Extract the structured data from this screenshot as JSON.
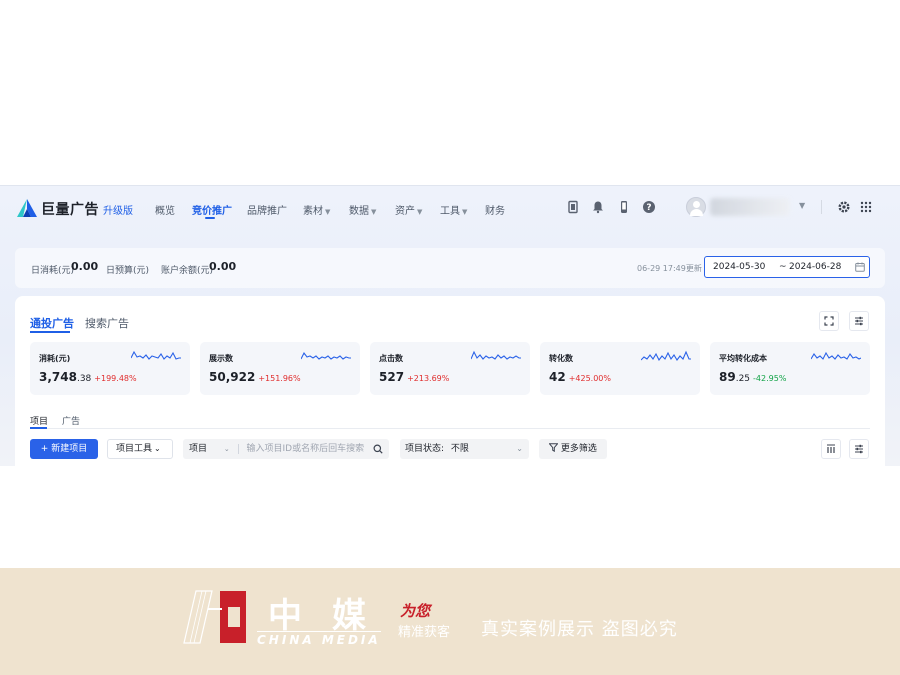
{
  "nav": {
    "brand": "巨量广告",
    "upgrade": "升级版",
    "items": [
      {
        "label": "概览"
      },
      {
        "label": "竞价推广",
        "active": true
      },
      {
        "label": "品牌推广"
      },
      {
        "label": "素材",
        "dropdown": true
      },
      {
        "label": "数据",
        "dropdown": true
      },
      {
        "label": "资产",
        "dropdown": true
      },
      {
        "label": "工具",
        "dropdown": true
      },
      {
        "label": "财务"
      }
    ],
    "icons": [
      "document-icon",
      "bell-icon",
      "phone-icon",
      "help-icon",
      "avatar",
      "settings-icon",
      "apps-grid-icon"
    ]
  },
  "summary": {
    "daily_spend_label": "日消耗(元)",
    "daily_spend_value": "0.00",
    "daily_budget_label": "日预算(元)",
    "balance_label": "账户余额(元)",
    "balance_value": "0.00",
    "update_time": "06-29 17:49更新",
    "date_start": "2024-05-30",
    "date_sep": "~",
    "date_end": "2024-06-28"
  },
  "card": {
    "tabs": [
      "通投广告",
      "搜索广告"
    ],
    "metrics": [
      {
        "label": "消耗(元)",
        "value_int": "3,748",
        "value_dec": ".38",
        "change": "+199.48%",
        "trend": "up"
      },
      {
        "label": "展示数",
        "value_int": "50,922",
        "value_dec": "",
        "change": "+151.96%",
        "trend": "up"
      },
      {
        "label": "点击数",
        "value_int": "527",
        "value_dec": "",
        "change": "+213.69%",
        "trend": "up"
      },
      {
        "label": "转化数",
        "value_int": "42",
        "value_dec": "",
        "change": "+425.00%",
        "trend": "up"
      },
      {
        "label": "平均转化成本",
        "value_int": "89",
        "value_dec": ".25",
        "change": "-42.95%",
        "trend": "down"
      }
    ],
    "subtabs": [
      "项目",
      "广告"
    ],
    "toolbar": {
      "new_project": "新建项目",
      "project_tools": "项目工具",
      "search_scope": "项目",
      "search_placeholder": "输入项目ID或名称后回车搜索",
      "status_label": "项目状态:",
      "status_value": "不限",
      "more_filters": "更多筛选"
    }
  },
  "watermark": {
    "zh": "中媒",
    "en": "CHINA MEDIA",
    "for_you": "为您",
    "precise": "精准获客",
    "showcase": "真实案例展示  盗图必究"
  },
  "colors": {
    "accent": "#1f5fe6",
    "up": "#e02e2e",
    "down": "#12a347",
    "footer_bg": "#efe3cf",
    "logo_red": "#c8202a"
  }
}
